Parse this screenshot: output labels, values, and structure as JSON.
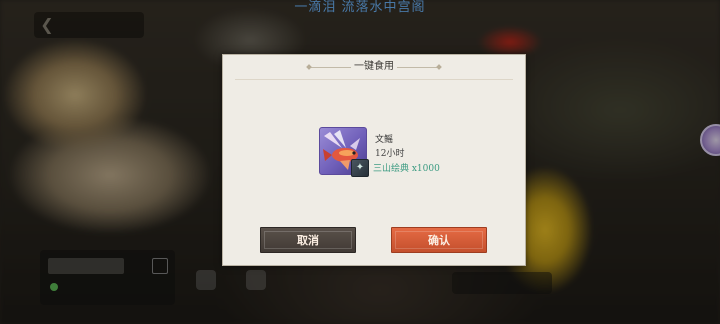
{
  "top_banner": {
    "text": "一滴泪 流落水中宫阁",
    "color": "#6fb8ff"
  },
  "dialog": {
    "title": "一键食用",
    "item": {
      "icon": "flying-fish-icon",
      "name": "文鳐",
      "duration": "12小时"
    },
    "reward": {
      "icon": "book-icon",
      "text": "三山绘典 x1000",
      "color": "#3e9c83"
    },
    "buttons": {
      "cancel": "取消",
      "confirm": "确认"
    }
  },
  "colors": {
    "confirm_button": "#d85c36",
    "cancel_button": "#4b433d",
    "dialog_background": "#efece5"
  }
}
